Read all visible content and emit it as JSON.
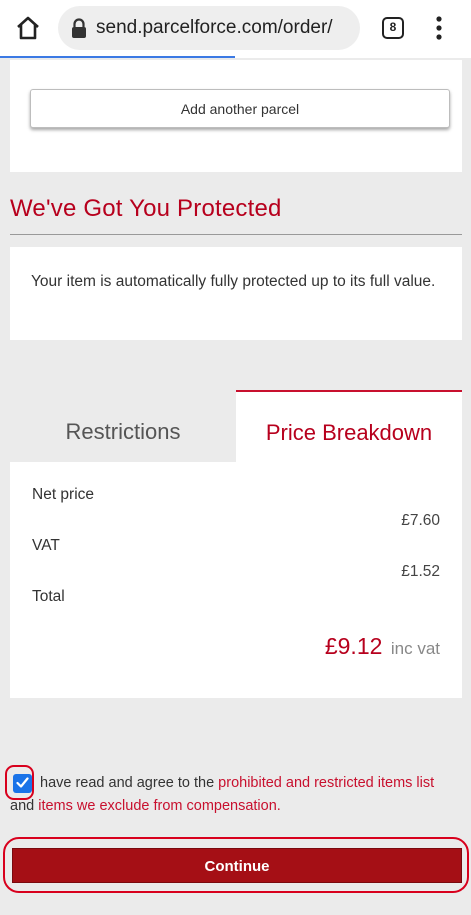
{
  "browser": {
    "url": "send.parcelforce.com/order/",
    "tab_count": "8"
  },
  "parcels": {
    "add_button_label": "Add another parcel"
  },
  "protection": {
    "title": "We've Got You Protected",
    "message": "Your item is automatically fully protected up to its full value."
  },
  "tabs": [
    {
      "label": "Restrictions",
      "active": false
    },
    {
      "label": "Price Breakdown",
      "active": true
    }
  ],
  "price": {
    "net_label": "Net price",
    "net_value": "£7.60",
    "vat_label": "VAT",
    "vat_value": "£1.52",
    "total_label": "Total",
    "total_value": "£9.12",
    "total_suffix": "inc vat"
  },
  "agreement": {
    "checked": true,
    "text_before": "have read and agree to the",
    "link_restricted": "prohibited and restricted items list",
    "text_and": "and",
    "link_exclude": "items we exclude from compensation."
  },
  "continue_label": "Continue",
  "colors": {
    "brand_red": "#b7001d",
    "button_red": "#a50f15",
    "highlight_red": "#d8001d",
    "checkbox_blue": "#1a73e8"
  }
}
